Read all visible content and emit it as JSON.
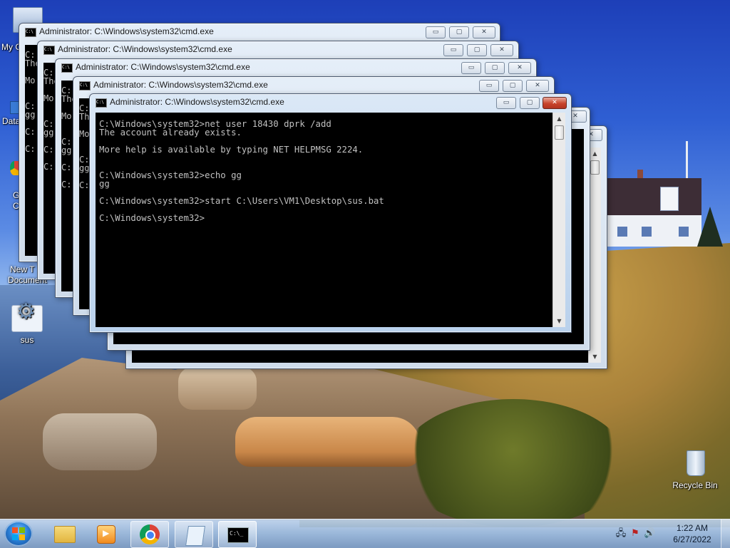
{
  "desktop": {
    "icons": [
      {
        "label": "sus",
        "icon": "batch-file-icon"
      },
      {
        "label": "Recycle Bin",
        "icon": "recycle-bin-icon"
      }
    ],
    "partial_labels": [
      "My C",
      "Data",
      "G",
      "C",
      "New T",
      "Document"
    ]
  },
  "windows": {
    "title": "Administrator: C:\\Windows\\system32\\cmd.exe",
    "controls": {
      "minimize": "▭",
      "maximize": "▢",
      "close": "✕"
    },
    "background_fragments": {
      "w1": "C:\nThe\n\nMo\n\n\nC:\ngg\n\nC:\n\nC:",
      "w2": "C:\nThe\n\nMo\n\n\nC:\ngg\n\nC:\n\nC:",
      "w3": "C:\nThe\n\nMo\n\n\nC:\ngg\n\nC:\n\nC:",
      "w4": "C:\nThe\n\nMo\n\n\nC:\ngg\n\nC:"
    },
    "active_console": "C:\\Windows\\system32>net user 18430 dprk /add\nThe account already exists.\n\nMore help is available by typing NET HELPMSG 2224.\n\n\nC:\\Windows\\system32>echo gg\ngg\n\nC:\\Windows\\system32>start C:\\Users\\VM1\\Desktop\\sus.bat\n\nC:\\Windows\\system32>"
  },
  "taskbar": {
    "items": [
      {
        "name": "windows-explorer",
        "icon": "folder-icon"
      },
      {
        "name": "media-player",
        "icon": "media-player-icon"
      },
      {
        "name": "google-chrome",
        "icon": "chrome-icon"
      },
      {
        "name": "notepad",
        "icon": "notepad-icon"
      },
      {
        "name": "command-prompt",
        "icon": "cmd-icon"
      }
    ],
    "clock": {
      "time": "1:22 AM",
      "date": "6/27/2022"
    }
  }
}
